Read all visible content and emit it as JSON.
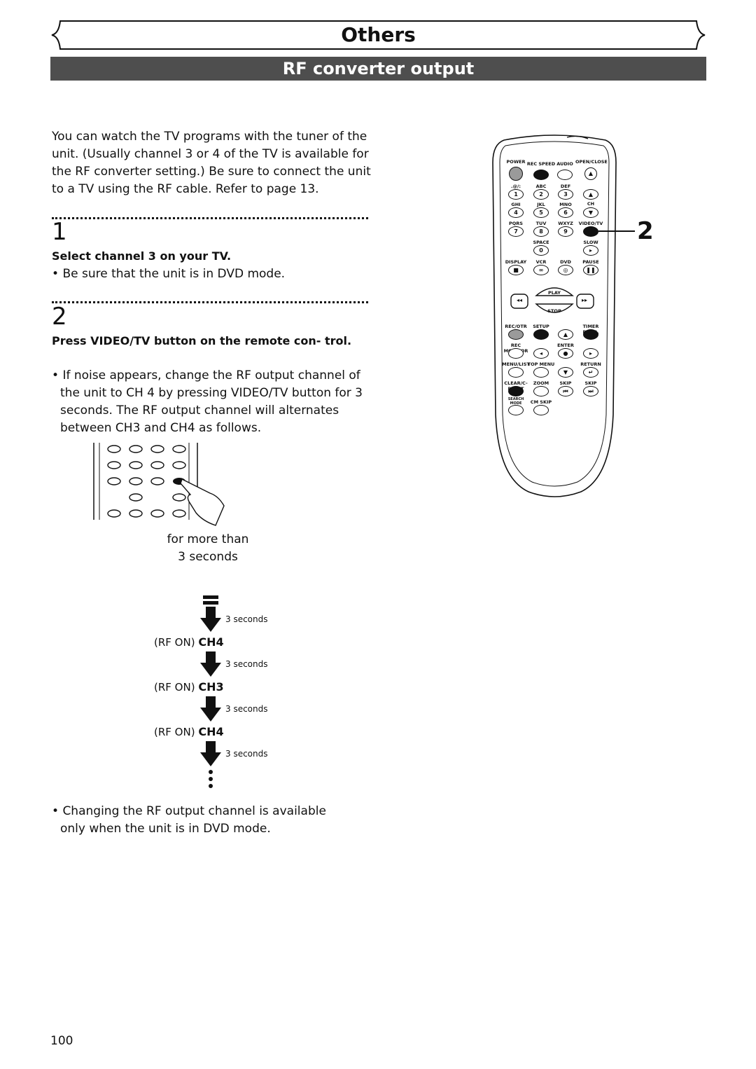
{
  "header": {
    "section": "Others",
    "title": "RF converter output"
  },
  "intro": "You can watch the TV programs with the tuner of the unit. (Usually channel 3 or 4 of the TV is available for the RF converter setting.) Be sure to connect the unit to a TV using the RF cable. Refer to page 13.",
  "steps": [
    {
      "number": "1",
      "heading": "Select channel 3 on your TV.",
      "bullets": [
        "Be sure that the unit is in DVD mode."
      ]
    },
    {
      "number": "2",
      "heading": "Press VIDEO/TV button on the remote con- trol.",
      "bullets": [
        "If noise appears, change the RF output channel of the unit to CH 4 by pressing VIDEO/TV button for 3 seconds. The RF output channel will alternates between CH3 and CH4 as follows."
      ]
    }
  ],
  "illustration_caption": [
    "for more than",
    "3 seconds"
  ],
  "flow": {
    "interval": "3 seconds",
    "states": [
      {
        "prefix": "(RF ON)",
        "channel": "CH4"
      },
      {
        "prefix": "(RF ON)",
        "channel": "CH3"
      },
      {
        "prefix": "(RF ON)",
        "channel": "CH4"
      }
    ]
  },
  "note": "Changing the RF output channel is available only when the unit is in DVD mode.",
  "callout": "2",
  "page_number": "100",
  "remote": {
    "labels": {
      "power": "POWER",
      "rec_speed": "REC SPEED",
      "audio": "AUDIO",
      "open_close": "OPEN/CLOSE",
      "k1": ".@/:",
      "k2": "ABC",
      "k3": "DEF",
      "k4": "GHI",
      "k5": "JKL",
      "k6": "MNO",
      "k7": "PQRS",
      "k8": "TUV",
      "k9": "WXYZ",
      "video_tv": "VIDEO/TV",
      "ch": "CH",
      "space": "SPACE",
      "slow": "SLOW",
      "display": "DISPLAY",
      "vcr": "VCR",
      "dvd": "DVD",
      "pause": "PAUSE",
      "play": "PLAY",
      "stop": "STOP",
      "rec_otr": "REC/OTR",
      "setup": "SETUP",
      "timer_prog": "TIMER PROG.",
      "rec_monitor": "REC MONITOR",
      "enter": "ENTER",
      "menu_list": "MENU/LIST",
      "top_menu": "TOP MENU",
      "return": "RETURN",
      "clear": "CLEAR/C-RESET",
      "zoom": "ZOOM",
      "skip": "SKIP",
      "search_mode": "SEARCH MODE",
      "cm_skip": "CM SKIP"
    },
    "digits": [
      "1",
      "2",
      "3",
      "4",
      "5",
      "6",
      "7",
      "8",
      "9",
      "0"
    ]
  }
}
